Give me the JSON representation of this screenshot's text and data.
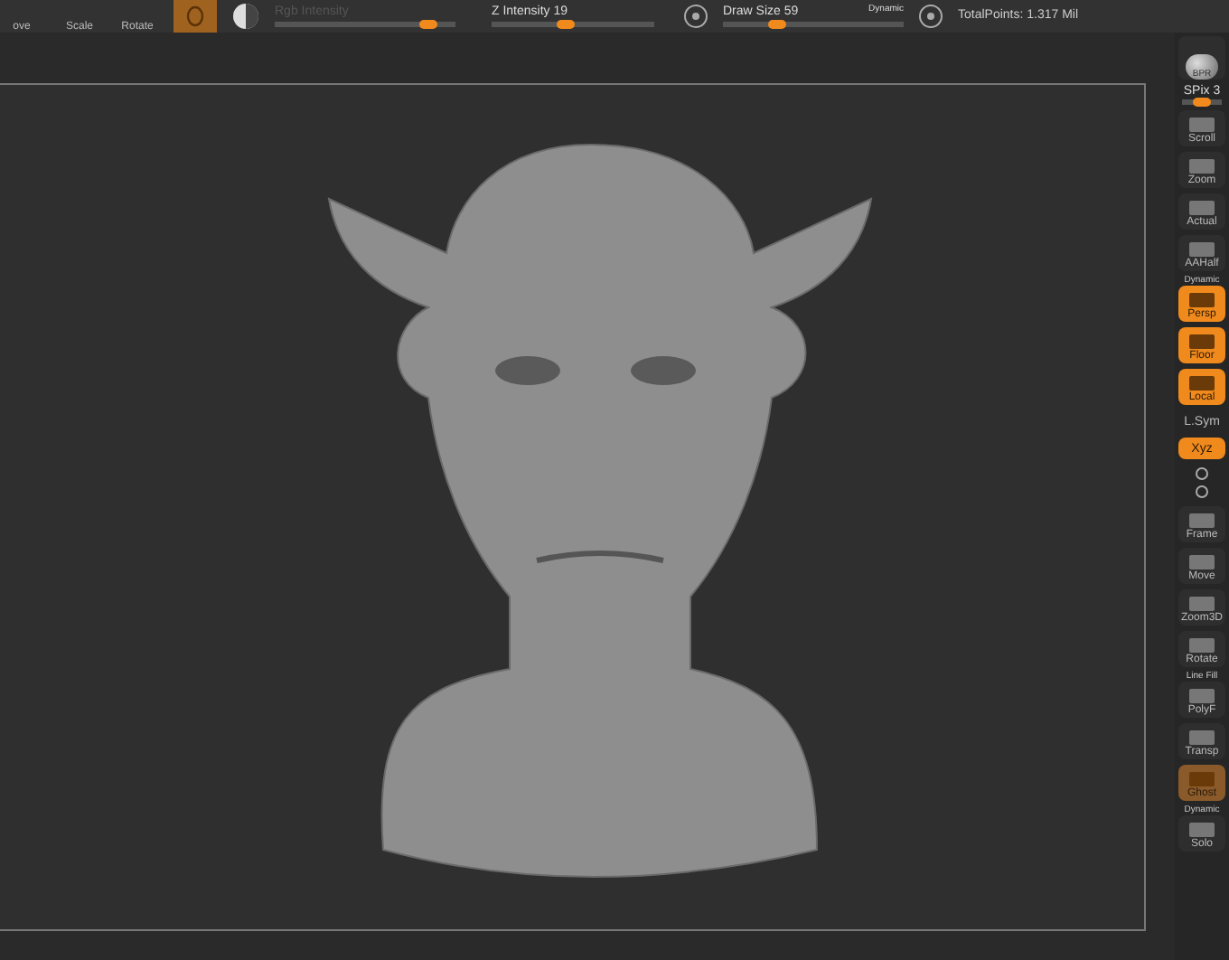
{
  "toolbar": {
    "transform_buttons": [
      {
        "label": "ove"
      },
      {
        "label": "Scale"
      },
      {
        "label": "Rotate"
      }
    ],
    "material_button": {
      "on": true
    },
    "rgb_intensity": {
      "label": "Rgb Intensity",
      "disabled": true,
      "level": 0.85
    },
    "z_intensity": {
      "label": "Z Intensity",
      "value": "19",
      "level": 0.45
    },
    "draw_size": {
      "label": "Draw Size",
      "value": "59",
      "level": 0.3,
      "dynamic": "Dynamic"
    },
    "total_points": "TotalPoints: 1.317 Mil"
  },
  "shelf": [
    {
      "kind": "sphere",
      "label": "BPR"
    },
    {
      "kind": "slider",
      "label": "SPix 3",
      "level": 0.5
    },
    {
      "kind": "button",
      "label": "Scroll",
      "on": false
    },
    {
      "kind": "button",
      "label": "Zoom",
      "on": false
    },
    {
      "kind": "button",
      "label": "Actual",
      "on": false
    },
    {
      "kind": "button",
      "label": "AAHalf",
      "on": false
    },
    {
      "kind": "button",
      "label": "Persp",
      "top": "Dynamic",
      "on": true
    },
    {
      "kind": "button",
      "label": "Floor",
      "on": true
    },
    {
      "kind": "button",
      "label": "Local",
      "on": true
    },
    {
      "kind": "small",
      "label": "L.Sym",
      "on": false
    },
    {
      "kind": "small",
      "label": "Xyz",
      "on": true
    },
    {
      "kind": "icons"
    },
    {
      "kind": "button",
      "label": "Frame",
      "on": false
    },
    {
      "kind": "button",
      "label": "Move",
      "on": false
    },
    {
      "kind": "button",
      "label": "Zoom3D",
      "on": false
    },
    {
      "kind": "button",
      "label": "Rotate",
      "on": false
    },
    {
      "kind": "button",
      "label": "PolyF",
      "top": "Line Fill",
      "on": false
    },
    {
      "kind": "button",
      "label": "Transp",
      "on": false
    },
    {
      "kind": "dim",
      "label": "Ghost",
      "on": true
    },
    {
      "kind": "button",
      "label": "Solo",
      "top": "Dynamic",
      "on": false
    }
  ]
}
